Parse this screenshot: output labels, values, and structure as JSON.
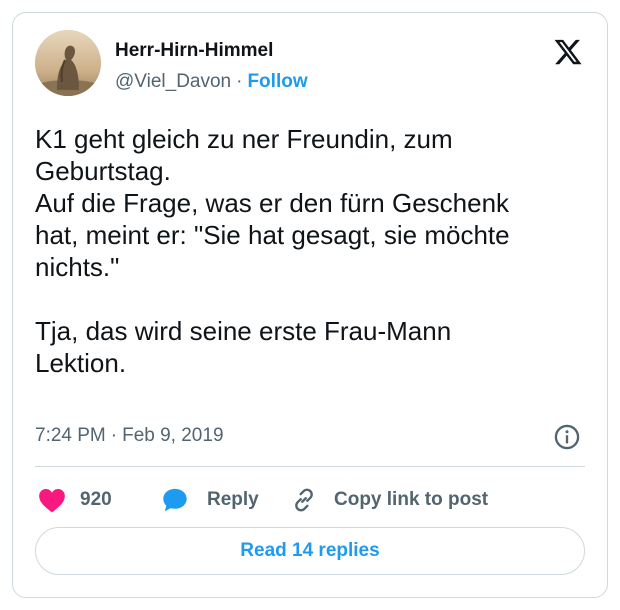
{
  "author": {
    "display_name": "Herr-Hirn-Himmel",
    "handle": "@Viel_Davon",
    "separator": "·",
    "follow_label": "Follow"
  },
  "tweet": {
    "lines": [
      "K1 geht gleich zu ner Freundin, zum",
      "Geburtstag.",
      "Auf die Frage, was er den fürn Geschenk",
      "hat, meint er: \"Sie hat gesagt, sie möchte",
      "nichts.\"",
      "Tja, das wird seine erste Frau-Mann",
      "Lektion."
    ],
    "time": "7:24 PM",
    "separator": "·",
    "date": "Feb 9, 2019"
  },
  "actions": {
    "like_count": "920",
    "reply_label": "Reply",
    "copy_label": "Copy link to post"
  },
  "read_replies_label": "Read 14 replies",
  "icons": {
    "brand": "x-logo-icon",
    "info": "info-icon",
    "like": "heart-icon",
    "reply": "speech-bubble-icon",
    "copy": "link-icon"
  },
  "colors": {
    "accent": "#1d9bf0",
    "like": "#f91880",
    "text": "#0f1419",
    "secondary_text": "#536471",
    "border": "#cfd9de"
  }
}
